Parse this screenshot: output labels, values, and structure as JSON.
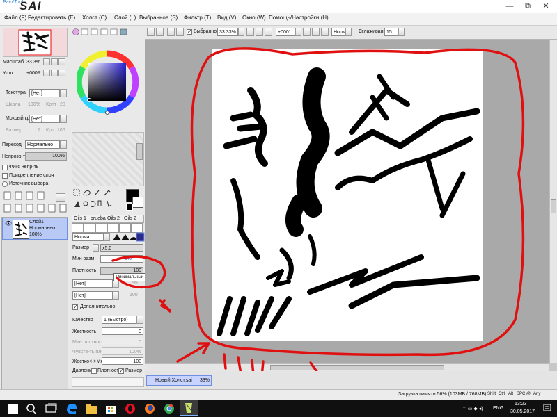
{
  "app": {
    "logo_top": "PaintTool",
    "logo_main": "SAI",
    "window_buttons": [
      "—",
      "⧉",
      "✕"
    ]
  },
  "menu": [
    "Файл (F)",
    "Редактировать (E)",
    "Холст (C)",
    "Слой (L)",
    "Выбранное (S)",
    "Фильтр (T)",
    "Вид (V)",
    "Окно (W)",
    "Помощь/Настройки (H)"
  ],
  "navigator": {
    "zoom_label": "Масштаб",
    "zoom_value": "33.3%",
    "angle_label": "Угол",
    "angle_value": "+000R"
  },
  "texture": {
    "texture_label": "Текстура",
    "texture_value": "[Нет]",
    "scale_label": "Шкала",
    "scale_value": "100%",
    "intensity_label": "Крпт",
    "intensity_value": "20",
    "wet_label": "Мокрый край",
    "wet_value": "[Нет]",
    "size_label": "Размер",
    "size_value": "1",
    "wet_intensity_label": "Крп",
    "wet_intensity_value": "100"
  },
  "blending": {
    "mode_label": "Переход",
    "mode_value": "Нормально",
    "opacity_label": "Непрозр-ть",
    "opacity_value": "100%",
    "clip_label": "Фикс непр-ть",
    "attach_label": "Прикрепление слоя",
    "source_label": "Источник выбора"
  },
  "layer": {
    "name": "Слой1",
    "mode": "Нормально",
    "opacity": "100%"
  },
  "brush": {
    "presets": [
      "Oils 1",
      "prueba",
      "Oils 2",
      "Oils 2"
    ],
    "mode_value": "Норма",
    "size_label": "Размер",
    "size_value": "x5.0",
    "min_size_label": "Мин разм",
    "min_size_value": "0%",
    "density_label": "Плотность",
    "density_value": "100",
    "texture1_value": "[Нет]",
    "texture1_num": "95",
    "texture2_value": "[Нет]",
    "texture2_num": "100",
    "advanced_label": "Дополнительно",
    "quality_label": "Качество",
    "quality_value": "1 (Быстро)",
    "hardness_label": "Жесткость",
    "hardness_value": "0",
    "min_density_label": "Мин плотность",
    "min_density_value": "0",
    "sensitivity_label": "Чувств-ть пл-ти",
    "sensitivity_value": "100%",
    "hard_soft_label": "Жестко<->Мягко",
    "hard_soft_value": "100",
    "pressure_label": "Давление:",
    "pressure_density": "Плотность",
    "pressure_size": "Размер",
    "tooltip": "Минимальный размер"
  },
  "toolbar": {
    "selection_label": "Выбранное",
    "zoom_value": "33.33%",
    "rotation_value": "+000°",
    "mode_value": "Норм",
    "stabilizer_label": "Сглаживание",
    "stabilizer_value": "15"
  },
  "documents": [
    {
      "name": "Новый Холст.sai",
      "zoom": "33%"
    }
  ],
  "status": {
    "memory": "Загрузка памяти:56% (103MB / 768MB)",
    "keys": [
      "Shift",
      "Ctrl",
      "Alt",
      "SPC",
      "@",
      "Any"
    ]
  },
  "taskbar": {
    "lang": "ENG",
    "time": "13:23",
    "date": "30.05.2017"
  },
  "colors": {
    "accent": "#2a6fd6",
    "annotation_red": "#e01010",
    "canvas_bg": "#a9a9a9"
  }
}
